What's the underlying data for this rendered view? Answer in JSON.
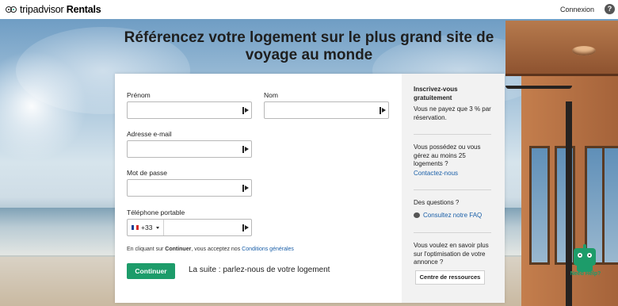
{
  "header": {
    "logo_main": "tripadvisor",
    "logo_sub": "Rentals",
    "signin_label": "Connexion",
    "help_label": "?"
  },
  "hero": {
    "heading": "Référencez votre logement sur le plus grand site de voyage au monde"
  },
  "form": {
    "first_name_label": "Prénom",
    "last_name_label": "Nom",
    "email_label": "Adresse e-mail",
    "password_label": "Mot de passe",
    "phone_label": "Téléphone portable",
    "phone_country_code": "+33",
    "first_name_value": "",
    "last_name_value": "",
    "email_value": "",
    "password_value": "",
    "phone_value": "",
    "terms_prefix": "En cliquant sur",
    "terms_bold": "Continuer",
    "terms_middle": ", vous acceptez nos",
    "terms_link": "Conditions générales",
    "continue_label": "Continuer",
    "next_step_text": "La suite : parlez-nous de votre logement"
  },
  "sidebar": {
    "signup_title": "Inscrivez-vous gratuitement",
    "signup_text": "Vous ne payez que 3 % par réservation.",
    "manager_text": "Vous possédez ou vous gérez au moins 25 logements ?",
    "contact_link": "Contactez-nous",
    "questions_text": "Des questions ?",
    "faq_link": "Consultez notre FAQ",
    "optimize_text": "Vous voulez en savoir plus sur l'optimisation de votre annonce ?",
    "resources_button": "Centre de ressources"
  },
  "chat_bot": {
    "label": "Need Help?"
  },
  "colors": {
    "accent_green": "#1d9c6a",
    "link_blue": "#1a5fa8"
  },
  "icons": {
    "logo": "owl-eyes-icon",
    "help": "question-circle-icon",
    "field_autofill": "keyboard-autofill-icon",
    "faq": "chat-bubble-icon",
    "flag": "france-flag-icon",
    "bot": "robot-icon"
  }
}
